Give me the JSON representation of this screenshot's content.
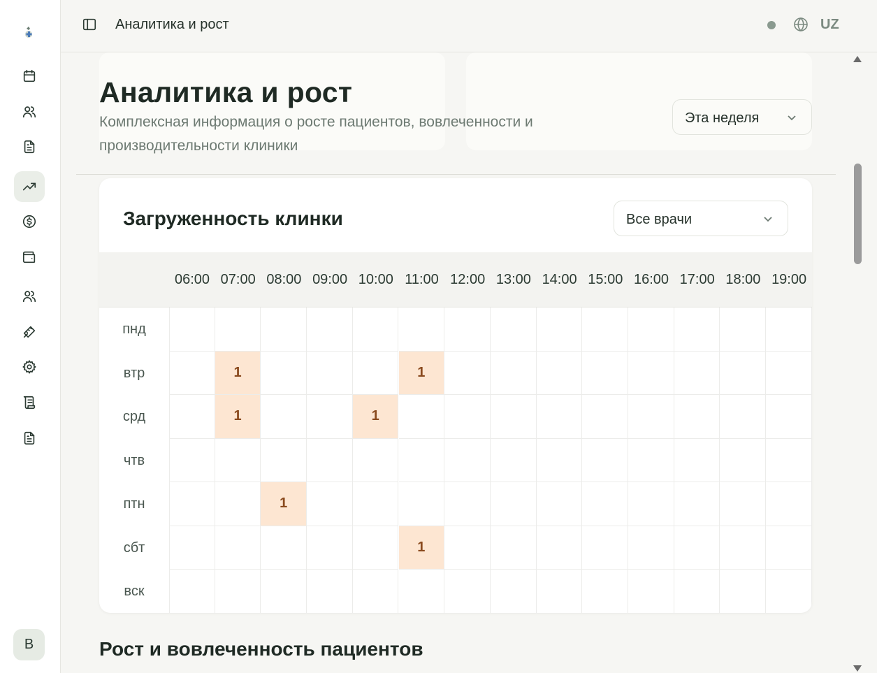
{
  "topbar": {
    "title": "Аналитика и рост",
    "language": "UZ"
  },
  "sidebar": {
    "avatar_initial": "B",
    "items": [
      {
        "icon": "calendar-icon"
      },
      {
        "icon": "users-icon"
      },
      {
        "icon": "document-icon"
      },
      {
        "icon": "trending-up-icon",
        "active": true
      },
      {
        "icon": "dollar-icon"
      },
      {
        "icon": "wallet-icon"
      },
      {
        "icon": "users-icon"
      },
      {
        "icon": "tools-icon"
      },
      {
        "icon": "settings-gear-icon"
      },
      {
        "icon": "scroll-icon"
      },
      {
        "icon": "document-icon"
      }
    ]
  },
  "header": {
    "title": "Аналитика и рост",
    "subtitle": "Комплексная информация о росте пациентов, вовлеченности и производительности клиники",
    "period_select": "Эта неделя"
  },
  "heatmap": {
    "title": "Загруженность клинки",
    "doctor_select": "Все врачи",
    "hours": [
      "06:00",
      "07:00",
      "08:00",
      "09:00",
      "10:00",
      "11:00",
      "12:00",
      "13:00",
      "14:00",
      "15:00",
      "16:00",
      "17:00",
      "18:00",
      "19:00"
    ],
    "days": [
      "пнд",
      "втр",
      "срд",
      "чтв",
      "птн",
      "сбт",
      "вск"
    ],
    "values": [
      [
        0,
        0,
        0,
        0,
        0,
        0,
        0,
        0,
        0,
        0,
        0,
        0,
        0,
        0
      ],
      [
        0,
        1,
        0,
        0,
        0,
        1,
        0,
        0,
        0,
        0,
        0,
        0,
        0,
        0
      ],
      [
        0,
        1,
        0,
        0,
        1,
        0,
        0,
        0,
        0,
        0,
        0,
        0,
        0,
        0
      ],
      [
        0,
        0,
        0,
        0,
        0,
        0,
        0,
        0,
        0,
        0,
        0,
        0,
        0,
        0
      ],
      [
        0,
        0,
        1,
        0,
        0,
        0,
        0,
        0,
        0,
        0,
        0,
        0,
        0,
        0
      ],
      [
        0,
        0,
        0,
        0,
        0,
        1,
        0,
        0,
        0,
        0,
        0,
        0,
        0,
        0
      ],
      [
        0,
        0,
        0,
        0,
        0,
        0,
        0,
        0,
        0,
        0,
        0,
        0,
        0,
        0
      ]
    ],
    "hot_color": "#fde6d2",
    "value_color": "#8a4a1e"
  },
  "section": {
    "title": "Рост и вовлеченность пациентов"
  },
  "colors": {
    "accent": "#2c3b33",
    "muted": "#6d7a72",
    "background": "#f6f6f3"
  }
}
